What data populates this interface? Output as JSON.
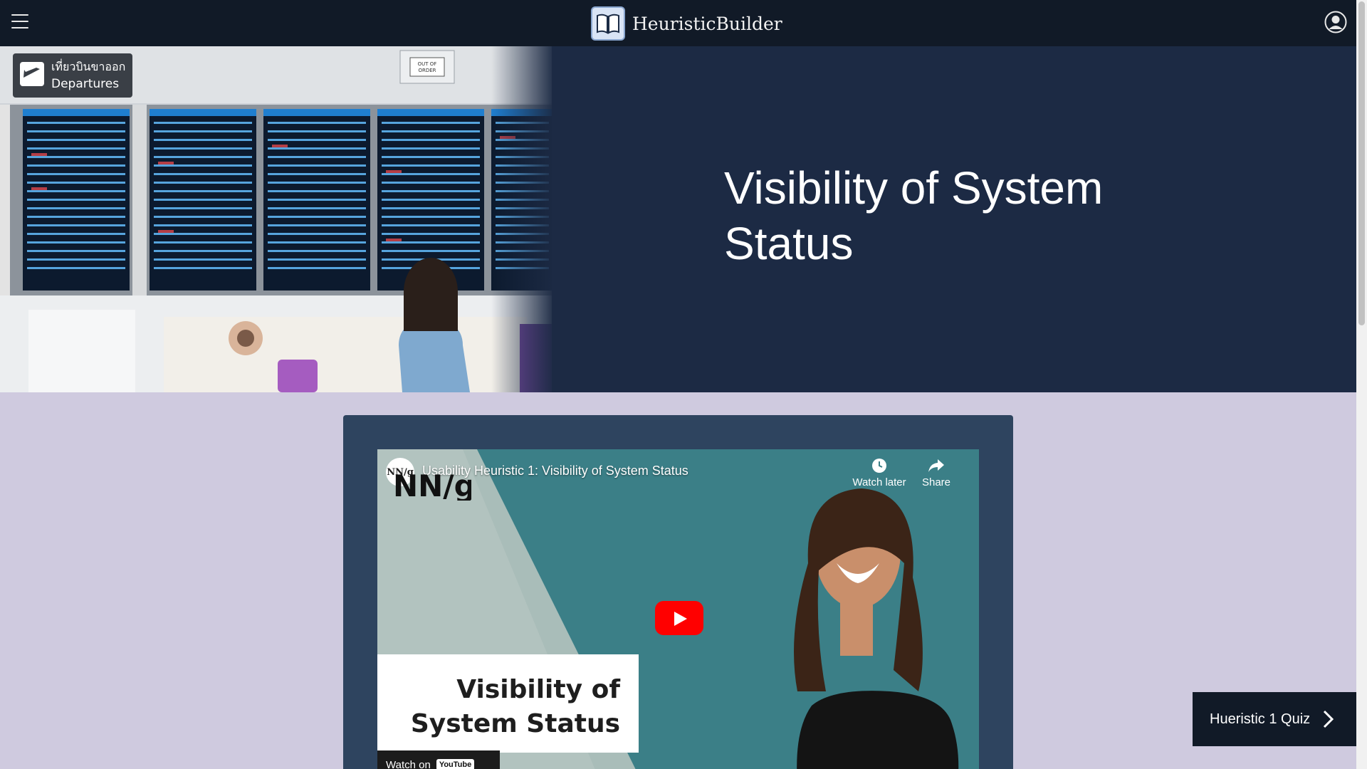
{
  "header": {
    "brand_name": "HeuristicBuilder",
    "icons": {
      "menu": "hamburger-menu-icon",
      "logo": "open-book-icon",
      "account": "user-circle-icon"
    }
  },
  "hero": {
    "title": "Visibility of System Status",
    "image": {
      "sign_thai": "เที่ยวบินขาออก",
      "sign_english": "Departures",
      "out_of_order": "OUT OF ORDER"
    }
  },
  "video": {
    "channel_avatar": "NN/g",
    "title": "Usability Heuristic 1: Visibility of System Status",
    "watch_later": "Watch later",
    "share": "Share",
    "thumbnail_brand": "NN/g",
    "thumbnail_text_line1": "Visibility of",
    "thumbnail_text_line2": "System Status",
    "watch_on": "Watch on",
    "youtube": "YouTube"
  },
  "quiz": {
    "label": "Hueristic 1 Quiz"
  },
  "colors": {
    "nav": "#111a27",
    "hero": "#1c2a44",
    "card": "#2e445f",
    "page": "#cfcadf",
    "youtube_red": "#ff0000"
  }
}
